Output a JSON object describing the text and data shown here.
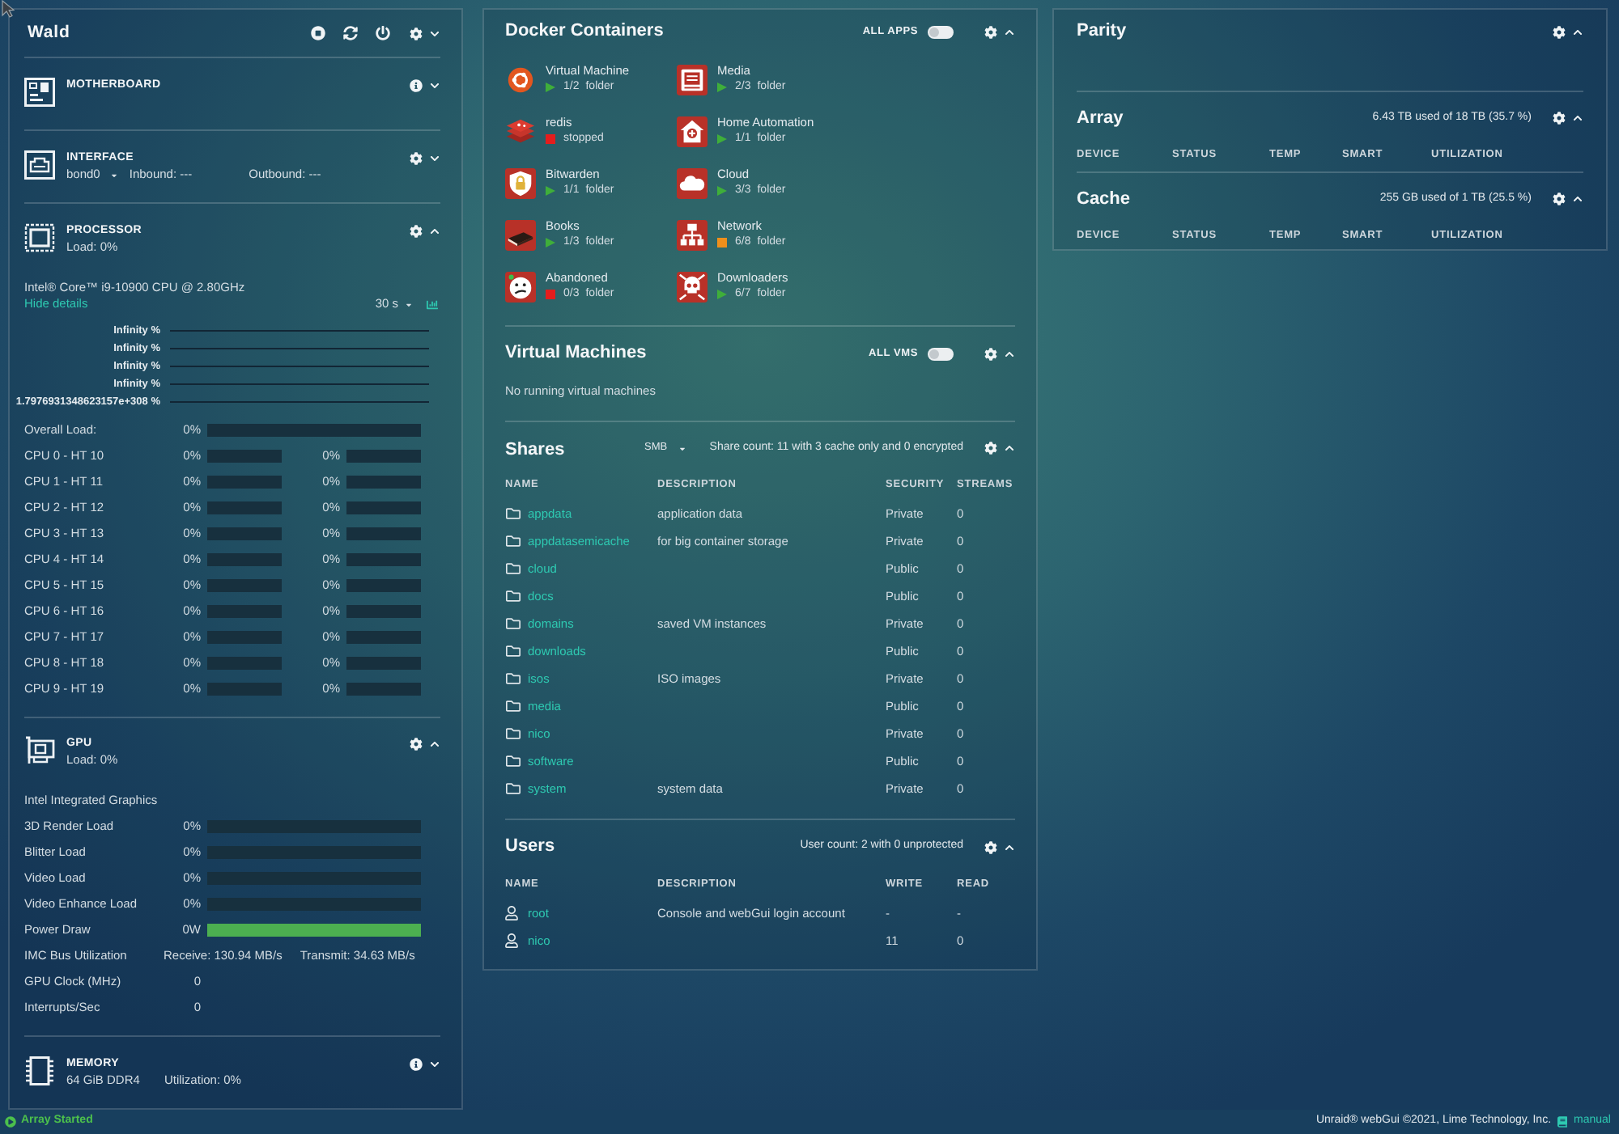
{
  "server": {
    "title": "Wald",
    "expanded": false,
    "sections": [
      {
        "kind": "motherboard",
        "title": "MOTHERBOARD",
        "expanded": false
      },
      {
        "kind": "interface",
        "title": "INTERFACE",
        "expanded": false,
        "interface": "bond0",
        "inbound": "Inbound: ---",
        "outbound": "Outbound: ---"
      },
      {
        "kind": "processor",
        "title": "PROCESSOR",
        "expanded": true,
        "load": "Load: 0%",
        "model": "Intel® Core™ i9-10900 CPU @ 2.80GHz",
        "details_link": "Hide details",
        "interval": "30 s",
        "graph_labels": [
          "Infinity %",
          "Infinity %",
          "Infinity %",
          "Infinity %",
          "1.7976931348623157e+308 %"
        ],
        "overall": {
          "label": "Overall Load:",
          "reading": "0%",
          "level": 0
        },
        "cpus": [
          {
            "label": "CPU 0 - HT 10",
            "cores": [
              {
                "reading": "0%",
                "level": 0
              },
              {
                "reading": "0%",
                "level": 0
              }
            ]
          },
          {
            "label": "CPU 1 - HT 11",
            "cores": [
              {
                "reading": "0%",
                "level": 0
              },
              {
                "reading": "0%",
                "level": 0
              }
            ]
          },
          {
            "label": "CPU 2 - HT 12",
            "cores": [
              {
                "reading": "0%",
                "level": 0
              },
              {
                "reading": "0%",
                "level": 0
              }
            ]
          },
          {
            "label": "CPU 3 - HT 13",
            "cores": [
              {
                "reading": "0%",
                "level": 0
              },
              {
                "reading": "0%",
                "level": 0
              }
            ]
          },
          {
            "label": "CPU 4 - HT 14",
            "cores": [
              {
                "reading": "0%",
                "level": 0
              },
              {
                "reading": "0%",
                "level": 0
              }
            ]
          },
          {
            "label": "CPU 5 - HT 15",
            "cores": [
              {
                "reading": "0%",
                "level": 0
              },
              {
                "reading": "0%",
                "level": 0
              }
            ]
          },
          {
            "label": "CPU 6 - HT 16",
            "cores": [
              {
                "reading": "0%",
                "level": 0
              },
              {
                "reading": "0%",
                "level": 0
              }
            ]
          },
          {
            "label": "CPU 7 - HT 17",
            "cores": [
              {
                "reading": "0%",
                "level": 0
              },
              {
                "reading": "0%",
                "level": 0
              }
            ]
          },
          {
            "label": "CPU 8 - HT 18",
            "cores": [
              {
                "reading": "0%",
                "level": 0
              },
              {
                "reading": "0%",
                "level": 0
              }
            ]
          },
          {
            "label": "CPU 9 - HT 19",
            "cores": [
              {
                "reading": "0%",
                "level": 0
              },
              {
                "reading": "0%",
                "level": 0
              }
            ]
          }
        ]
      },
      {
        "kind": "gpu",
        "title": "GPU",
        "expanded": true,
        "load": "Load: 0%",
        "model": "Intel Integrated Graphics",
        "metrics": [
          {
            "kind": "bar",
            "label": "3D Render Load",
            "reading": "0%",
            "level": 0
          },
          {
            "kind": "bar",
            "label": "Blitter Load",
            "reading": "0%",
            "level": 0
          },
          {
            "kind": "bar",
            "label": "Video Load",
            "reading": "0%",
            "level": 0
          },
          {
            "kind": "bar",
            "label": "Video Enhance Load",
            "reading": "0%",
            "level": 0
          },
          {
            "kind": "bar",
            "label": "Power Draw",
            "reading": "0W",
            "level": 1
          },
          {
            "kind": "transfer",
            "label": "IMC Bus Utilization",
            "receive": "Receive: 130.94 MB/s",
            "transmit": "Transmit: 34.63 MB/s"
          },
          {
            "kind": "value",
            "label": "GPU Clock (MHz)",
            "value": "0"
          },
          {
            "kind": "value",
            "label": "Interrupts/Sec",
            "value": "0"
          }
        ]
      },
      {
        "kind": "memory",
        "title": "MEMORY",
        "expanded": false,
        "size": "64 GiB DDR4",
        "utilization": "Utilization: 0%"
      }
    ]
  },
  "docker": {
    "title": "Docker Containers",
    "expanded": true,
    "toggle": {
      "label": "ALL APPS",
      "on": false
    },
    "containers": [
      {
        "name": "Virtual Machine",
        "running": true,
        "color": "#3fae3a",
        "status": "1/2",
        "type_label": "folder"
      },
      {
        "name": "Media",
        "running": true,
        "color": "#3fae3a",
        "status": "2/3",
        "type_label": "folder"
      },
      {
        "name": "redis",
        "running": false,
        "color": "#e41d1d",
        "status": "stopped"
      },
      {
        "name": "Home Automation",
        "running": true,
        "color": "#3fae3a",
        "status": "1/1",
        "type_label": "folder"
      },
      {
        "name": "Bitwarden",
        "running": true,
        "color": "#3fae3a",
        "status": "1/1",
        "type_label": "folder"
      },
      {
        "name": "Cloud",
        "running": true,
        "color": "#3fae3a",
        "status": "3/3",
        "type_label": "folder"
      },
      {
        "name": "Books",
        "running": true,
        "color": "#3fae3a",
        "status": "1/3",
        "type_label": "folder"
      },
      {
        "name": "Network",
        "running": false,
        "color": "#ef8f1b",
        "status": "6/8",
        "type_label": "folder"
      },
      {
        "name": "Abandoned",
        "running": false,
        "color": "#e41d1d",
        "status": "0/3",
        "type_label": "folder"
      },
      {
        "name": "Downloaders",
        "running": true,
        "color": "#3fae3a",
        "status": "6/7",
        "type_label": "folder"
      }
    ]
  },
  "vms": {
    "title": "Virtual Machines",
    "expanded": true,
    "toggle": {
      "label": "ALL VMS",
      "on": false
    },
    "message": "No running virtual machines"
  },
  "shares": {
    "title": "Shares",
    "expanded": true,
    "protocol": "SMB",
    "summary": "Share count: 11 with 3 cache only and 0 encrypted",
    "columns": [
      "NAME",
      "DESCRIPTION",
      "SECURITY",
      "STREAMS"
    ],
    "rows": [
      {
        "name": "appdata",
        "description": "application data",
        "security": "Private",
        "streams": "0"
      },
      {
        "name": "appdatasemicache",
        "description": "for big container storage",
        "security": "Private",
        "streams": "0"
      },
      {
        "name": "cloud",
        "security": "Public",
        "streams": "0"
      },
      {
        "name": "docs",
        "security": "Public",
        "streams": "0"
      },
      {
        "name": "domains",
        "description": "saved VM instances",
        "security": "Private",
        "streams": "0"
      },
      {
        "name": "downloads",
        "security": "Public",
        "streams": "0"
      },
      {
        "name": "isos",
        "description": "ISO images",
        "security": "Private",
        "streams": "0"
      },
      {
        "name": "media",
        "security": "Public",
        "streams": "0"
      },
      {
        "name": "nico",
        "security": "Private",
        "streams": "0"
      },
      {
        "name": "software",
        "security": "Public",
        "streams": "0"
      },
      {
        "name": "system",
        "description": "system data",
        "security": "Private",
        "streams": "0"
      }
    ]
  },
  "users": {
    "title": "Users",
    "expanded": true,
    "summary": "User count: 2 with 0 unprotected",
    "columns": [
      "NAME",
      "DESCRIPTION",
      "WRITE",
      "READ"
    ],
    "rows": [
      {
        "name": "root",
        "description": "Console and webGui login account",
        "write": "-",
        "read": "-"
      },
      {
        "name": "nico",
        "write": "11",
        "read": "0"
      }
    ]
  },
  "parity": {
    "title": "Parity",
    "expanded": true
  },
  "array": {
    "title": "Array",
    "expanded": true,
    "usage": "6.43 TB used of 18 TB (35.7 %)",
    "columns": [
      "DEVICE",
      "STATUS",
      "TEMP",
      "SMART",
      "UTILIZATION"
    ]
  },
  "cache": {
    "title": "Cache",
    "expanded": true,
    "usage": "255 GB used of 1 TB (25.5 %)",
    "columns": [
      "DEVICE",
      "STATUS",
      "TEMP",
      "SMART",
      "UTILIZATION"
    ]
  },
  "status_bar": {
    "status": "Array Started",
    "copyright": "Unraid® webGui ©2021, Lime Technology, Inc.",
    "manual_link": "manual"
  }
}
